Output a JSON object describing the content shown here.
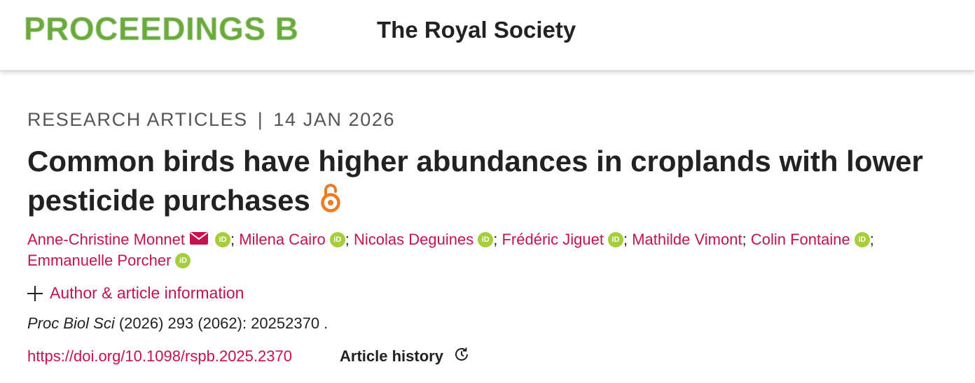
{
  "header": {
    "journal_name": "PROCEEDINGS B",
    "society_name": "The Royal Society"
  },
  "article": {
    "type": "RESEARCH ARTICLES",
    "separator": "|",
    "date": "14 JAN 2026",
    "title": "Common birds have higher abundances in croplands with lower pesticide purchases",
    "open_access_icon": "open-access-icon",
    "authors": [
      {
        "name": "Anne-Christine Monnet",
        "orcid": true
      },
      {
        "name": "Milena Cairo",
        "orcid": true
      },
      {
        "name": "Nicolas Deguines",
        "orcid": true
      },
      {
        "name": "Frédéric Jiguet",
        "orcid": true
      },
      {
        "name": "Mathilde Vimont",
        "orcid": false
      },
      {
        "name": "Colin Fontaine",
        "orcid": true
      },
      {
        "name": "Emmanuelle Porcher",
        "orcid": true
      }
    ],
    "author_separator": ";",
    "orcid_label": "iD",
    "info_toggle_label": "Author & article information",
    "citation": {
      "journal": "Proc Biol Sci",
      "details": " (2026) 293 (2062): 20252370 ."
    },
    "doi": "https://doi.org/10.1098/rspb.2025.2370",
    "history_label": "Article history"
  },
  "colors": {
    "brand_green": "#6aaa3d",
    "link_red": "#c4134c",
    "open_access_orange": "#f07a22",
    "orcid_green": "#a6ce39"
  }
}
